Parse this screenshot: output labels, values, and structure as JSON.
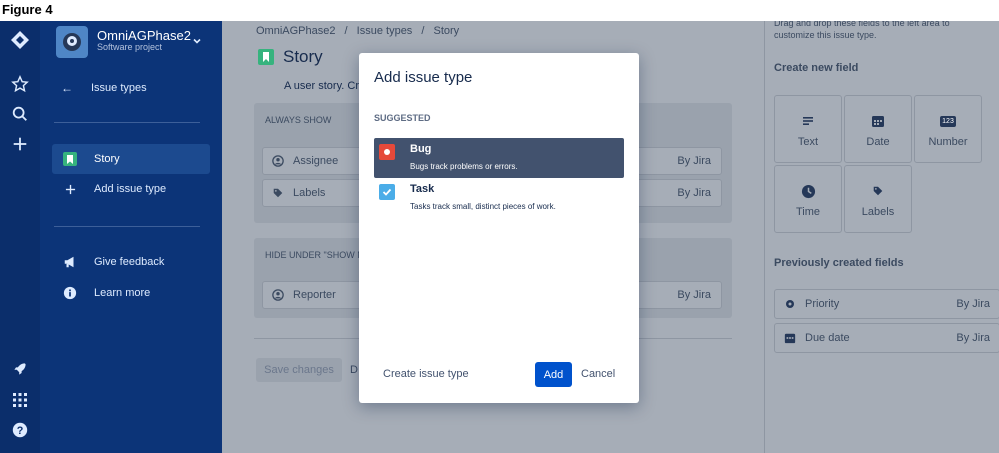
{
  "figure_label": "Figure 4",
  "project": {
    "name": "OmniAGPhase2",
    "type": "Software project"
  },
  "sidebar": {
    "back_label": "Issue types",
    "items": [
      {
        "label": "Story"
      },
      {
        "label": "Add issue type"
      }
    ],
    "footer": [
      {
        "label": "Give feedback"
      },
      {
        "label": "Learn more"
      }
    ]
  },
  "breadcrumbs": [
    "OmniAGPhase2",
    "/",
    "Issue types",
    "/",
    "Story"
  ],
  "page": {
    "title": "Story",
    "description": "A user story. Cre",
    "sections": [
      {
        "heading": "ALWAYS SHOW",
        "fields": [
          {
            "name": "Assignee",
            "source": "By Jira",
            "icon": "user-icon"
          },
          {
            "name": "Labels",
            "source": "By Jira",
            "icon": "tag-icon"
          }
        ]
      },
      {
        "heading": "HIDE UNDER \"SHOW M",
        "fields": [
          {
            "name": "Reporter",
            "source": "By Jira",
            "icon": "user-icon"
          }
        ]
      }
    ],
    "save_label": "Save changes",
    "discard_label": "D"
  },
  "right_panel": {
    "hint": "Drag and drop these fields to the left area to customize this issue type.",
    "create_title": "Create new field",
    "tiles": [
      {
        "label": "Text",
        "icon": "text-icon"
      },
      {
        "label": "Date",
        "icon": "calendar-icon"
      },
      {
        "label": "Number",
        "icon": "number-icon",
        "badge": "123"
      },
      {
        "label": "Time",
        "icon": "clock-icon"
      },
      {
        "label": "Labels",
        "icon": "tag-icon"
      }
    ],
    "previous_title": "Previously created fields",
    "previous": [
      {
        "name": "Priority",
        "source": "By Jira",
        "icon": "priority-icon"
      },
      {
        "name": "Due date",
        "source": "By Jira",
        "icon": "calendar-icon"
      }
    ]
  },
  "modal": {
    "title": "Add issue type",
    "section_label": "SUGGESTED",
    "options": [
      {
        "name": "Bug",
        "description": "Bugs track problems or errors.",
        "icon": "bug-icon",
        "color": "#e5493a",
        "selected": true
      },
      {
        "name": "Task",
        "description": "Tasks track small, distinct pieces of work.",
        "icon": "task-icon",
        "color": "#4bade8",
        "selected": false
      }
    ],
    "create_label": "Create issue type",
    "add_label": "Add",
    "cancel_label": "Cancel"
  },
  "colors": {
    "rail": "#0b2e6b",
    "sidebar": "#0c3478",
    "primary": "#0052cc",
    "story": "#36b37e",
    "overlay": "#a6adb7"
  }
}
